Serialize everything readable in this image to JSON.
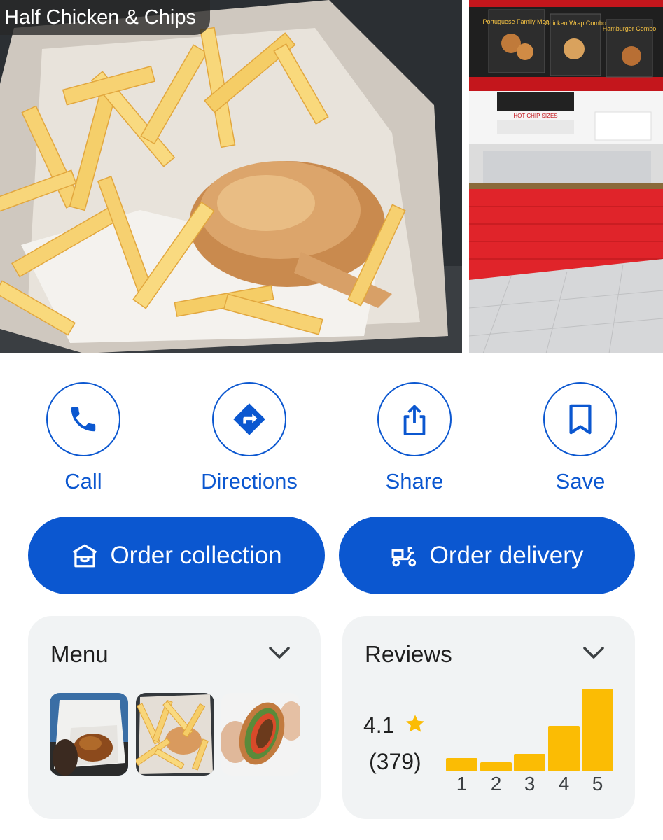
{
  "photos": {
    "main_caption": "Half Chicken & Chips",
    "side_signs": [
      "Portuguese Family Meal",
      "Chicken Wrap Combo",
      "Hamburger Combo"
    ],
    "side_banner": "HOT CHIP SIZES"
  },
  "actions": [
    {
      "label": "Call",
      "icon": "phone-icon"
    },
    {
      "label": "Directions",
      "icon": "directions-icon"
    },
    {
      "label": "Share",
      "icon": "share-icon"
    },
    {
      "label": "Save",
      "icon": "bookmark-icon"
    }
  ],
  "order": {
    "collection_label": "Order collection",
    "delivery_label": "Order delivery"
  },
  "menu_card": {
    "title": "Menu"
  },
  "reviews_card": {
    "title": "Reviews",
    "rating": "4.1",
    "count": "(379)",
    "distribution": [
      {
        "stars": "1",
        "share": 0.16
      },
      {
        "stars": "2",
        "share": 0.11
      },
      {
        "stars": "3",
        "share": 0.21
      },
      {
        "stars": "4",
        "share": 0.55
      },
      {
        "stars": "5",
        "share": 1.0
      }
    ]
  },
  "colors": {
    "accent": "#0b57d0",
    "star": "#fbbc04",
    "card_bg": "#f1f3f4"
  }
}
